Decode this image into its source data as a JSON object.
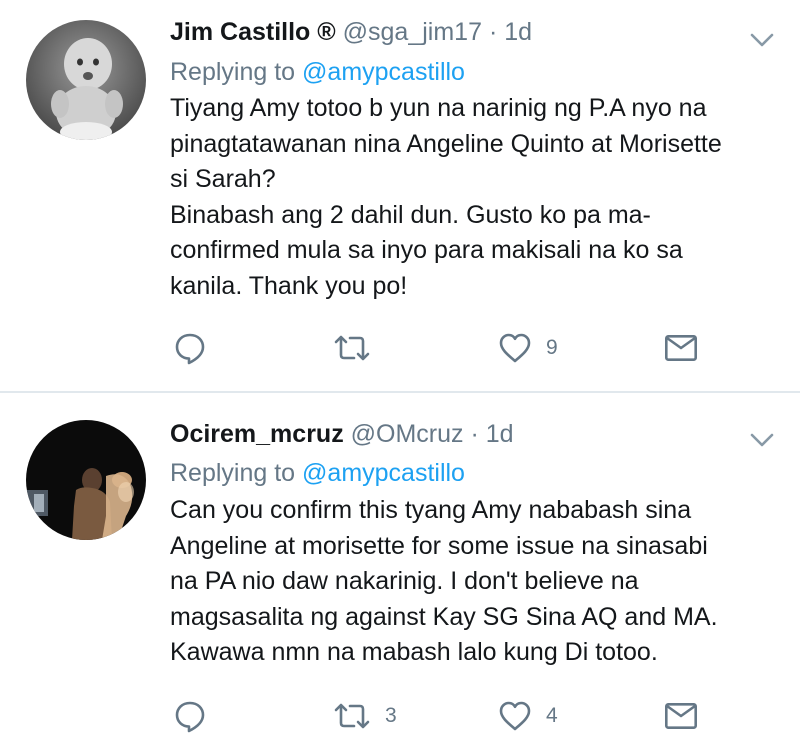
{
  "accent_color": "#1da1f2",
  "tweets": [
    {
      "name": "Jim Castillo ®",
      "handle": "@sga_jim17",
      "separator": "·",
      "time": "1d",
      "replying_prefix": "Replying to",
      "replying_to": "@amypcastillo",
      "lines": [
        "Tiyang Amy totoo b yun na narinig ng P.A nyo na",
        "pinagtatawanan nina Angeline Quinto at Morisette",
        "si Sarah?",
        "Binabash ang 2 dahil dun. Gusto ko pa ma-",
        "confirmed mula sa inyo para makisali na ko sa",
        "kanila. Thank you po!"
      ],
      "actions": {
        "reply_icon": "reply-icon",
        "retweet_icon": "retweet-icon",
        "retweet_count": "",
        "like_icon": "heart-icon",
        "like_count": "9",
        "dm_icon": "envelope-icon"
      }
    },
    {
      "name": "Ocirem_mcruz",
      "handle": "@OMcruz",
      "separator": "·",
      "time": "1d",
      "replying_prefix": "Replying to",
      "replying_to": "@amypcastillo",
      "lines": [
        "Can you confirm this tyang Amy nababash sina",
        "Angeline at morisette for some issue na sinasabi",
        "na PA nio daw nakarinig.  I don't believe na",
        "magsasalita ng against Kay SG Sina AQ and MA.",
        "Kawawa nmn na mabash lalo kung Di totoo."
      ],
      "actions": {
        "reply_icon": "reply-icon",
        "retweet_icon": "retweet-icon",
        "retweet_count": "3",
        "like_icon": "heart-icon",
        "like_count": "4",
        "dm_icon": "envelope-icon"
      }
    }
  ]
}
